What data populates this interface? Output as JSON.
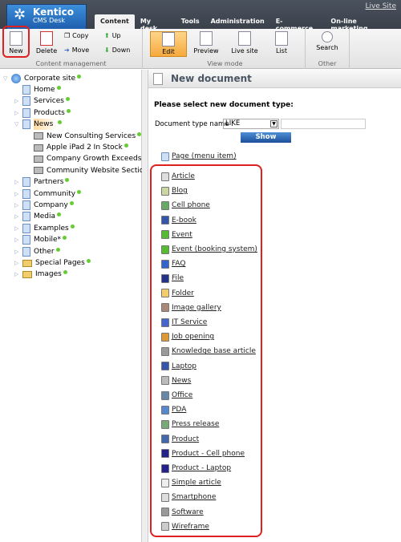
{
  "header": {
    "logo_brand": "Kentico",
    "logo_product": "CMS Desk",
    "live_site": "Live Site",
    "tabs": [
      "Content",
      "My desk",
      "Tools",
      "Administration",
      "E-commerce",
      "On-line marketing"
    ]
  },
  "toolbar": {
    "new": "New",
    "delete": "Delete",
    "copy": "Copy",
    "move": "Move",
    "up": "Up",
    "down": "Down",
    "group_content": "Content management",
    "edit": "Edit",
    "preview": "Preview",
    "live_site": "Live site",
    "list": "List",
    "group_view": "View mode",
    "search": "Search",
    "group_other": "Other"
  },
  "tree": {
    "root": "Corporate site",
    "items": [
      "Home",
      "Services",
      "Products",
      "News",
      "Partners",
      "Community",
      "Company",
      "Media",
      "Examples",
      "Mobile",
      "Other",
      "Special Pages",
      "Images"
    ],
    "news_children": [
      "New Consulting Services",
      "Apple iPad 2 In Stock",
      "Company Growth Exceeds E",
      "Community Website Section"
    ],
    "mobile_mark": "*"
  },
  "main": {
    "title": "New document",
    "prompt": "Please select new document type:",
    "filter_label": "Document type name :",
    "filter_operator": "LIKE",
    "filter_value": "",
    "show": "Show",
    "page_item": "Page (menu item)",
    "doc_types": [
      "Article",
      "Blog",
      "Cell phone",
      "E-book",
      "Event",
      "Event (booking system)",
      "FAQ",
      "File",
      "Folder",
      "Image gallery",
      "IT Service",
      "Job opening",
      "Knowledge base article",
      "Laptop",
      "News",
      "Office",
      "PDA",
      "Press release",
      "Product",
      "Product - Cell phone",
      "Product - Laptop",
      "Simple article",
      "Smartphone",
      "Software",
      "Wireframe"
    ]
  },
  "colors": {
    "highlight": "#e02020",
    "accent": "#1f5fae",
    "selected": "#ffd9a0"
  }
}
